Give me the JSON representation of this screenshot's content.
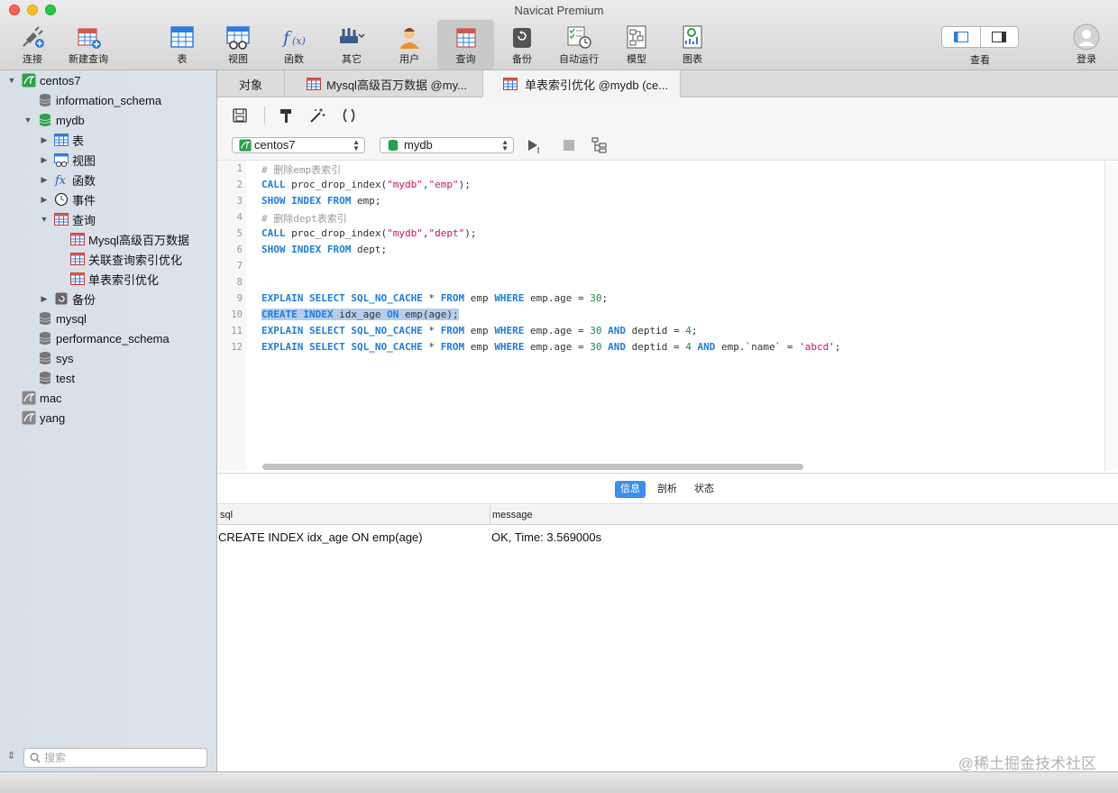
{
  "window": {
    "title": "Navicat Premium"
  },
  "toolbar": {
    "items": [
      {
        "label": "连接",
        "icon": "connection-plug-icon"
      },
      {
        "label": "新建查询",
        "icon": "new-query-icon"
      },
      {
        "label": "表",
        "icon": "table-icon"
      },
      {
        "label": "视图",
        "icon": "view-icon"
      },
      {
        "label": "函数",
        "icon": "function-icon"
      },
      {
        "label": "其它",
        "icon": "tools-icon"
      },
      {
        "label": "用户",
        "icon": "user-icon"
      },
      {
        "label": "查询",
        "icon": "query-icon"
      },
      {
        "label": "备份",
        "icon": "backup-icon"
      },
      {
        "label": "自动运行",
        "icon": "automation-icon"
      },
      {
        "label": "模型",
        "icon": "model-icon"
      },
      {
        "label": "图表",
        "icon": "chart-icon"
      }
    ],
    "view_label": "查看",
    "login_label": "登录"
  },
  "sidebar": {
    "tree": [
      {
        "label": "centos7",
        "icon": "mysql-connection-icon"
      },
      {
        "label": "information_schema",
        "icon": "database-icon"
      },
      {
        "label": "mydb",
        "icon": "database-open-icon"
      },
      {
        "label": "表",
        "icon": "table-icon"
      },
      {
        "label": "视图",
        "icon": "view-icon"
      },
      {
        "label": "函数",
        "icon": "function-icon"
      },
      {
        "label": "事件",
        "icon": "event-clock-icon"
      },
      {
        "label": "查询",
        "icon": "query-icon"
      },
      {
        "label": "Mysql高级百万数据",
        "icon": "query-icon"
      },
      {
        "label": "关联查询索引优化",
        "icon": "query-icon"
      },
      {
        "label": "单表索引优化",
        "icon": "query-icon"
      },
      {
        "label": "备份",
        "icon": "backup-icon"
      },
      {
        "label": "mysql",
        "icon": "database-icon"
      },
      {
        "label": "performance_schema",
        "icon": "database-icon"
      },
      {
        "label": "sys",
        "icon": "database-icon"
      },
      {
        "label": "test",
        "icon": "database-icon"
      },
      {
        "label": "mac",
        "icon": "mysql-connection-icon"
      },
      {
        "label": "yang",
        "icon": "mysql-connection-icon"
      }
    ],
    "search_placeholder": "搜索"
  },
  "tabs": [
    {
      "label": "对象"
    },
    {
      "label": "Mysql高级百万数据 @my..."
    },
    {
      "label": "单表索引优化 @mydb (ce..."
    }
  ],
  "query": {
    "connection": "centos7",
    "database": "mydb",
    "line_numbers": [
      "1",
      "2",
      "3",
      "4",
      "5",
      "6",
      "7",
      "8",
      "9",
      "10",
      "11",
      "12"
    ]
  },
  "results": {
    "tabs": [
      "信息",
      "剖析",
      "状态"
    ],
    "columns": [
      "sql",
      "message"
    ],
    "rows": [
      {
        "sql": "CREATE INDEX idx_age ON emp(age)",
        "message": "OK, Time: 3.569000s"
      }
    ]
  },
  "watermark": "@稀土掘金技术社区",
  "colors": {
    "keyword": "#1d7fe0",
    "string": "#d0174a",
    "number": "#1a8e4a",
    "selection": "#b4cdea",
    "active_tab": "#3a8ef0"
  }
}
